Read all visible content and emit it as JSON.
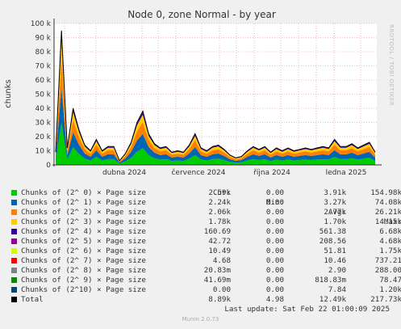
{
  "chart_data": {
    "type": "area",
    "title": "Node 0, zone Normal - by year",
    "ylabel": "chunks",
    "ylim": [
      0,
      100000
    ],
    "yticks": [
      0,
      10000,
      20000,
      30000,
      40000,
      50000,
      60000,
      70000,
      80000,
      90000,
      100000
    ],
    "ytick_labels": [
      "0",
      "10 k",
      "20 k",
      "30 k",
      "40 k",
      "50 k",
      "60 k",
      "70 k",
      "80 k",
      "90 k",
      "100 k"
    ],
    "x_tick_labels": [
      "dubna 2024",
      "července 2024",
      "října 2024",
      "ledna 2025"
    ],
    "grid": true,
    "stacked": true,
    "total_line_color": "#000000",
    "series_colors": [
      "#00cc00",
      "#0066b3",
      "#ff8000",
      "#ffcc00",
      "#330099",
      "#990099",
      "#ccff00",
      "#ff0000",
      "#808080",
      "#008f00",
      "#00487d"
    ],
    "total_values": [
      9000,
      95000,
      12000,
      40000,
      25000,
      14000,
      10000,
      18000,
      10000,
      13000,
      13000,
      3000,
      8000,
      16000,
      30000,
      38000,
      22000,
      15000,
      12000,
      13000,
      9000,
      10000,
      9000,
      14000,
      22000,
      12000,
      10000,
      13000,
      14000,
      11000,
      7000,
      5000,
      6000,
      10000,
      13000,
      11000,
      13000,
      9000,
      12000,
      10000,
      12000,
      10000,
      11000,
      12000,
      11000,
      12000,
      13000,
      12000,
      18000,
      13000,
      13000,
      15000,
      12000,
      14000,
      16000,
      9000
    ]
  },
  "legend": {
    "headers": {
      "cur": "Cur:",
      "min": "Min:",
      "avg": "Avg:",
      "max": "Max:"
    },
    "rows": [
      {
        "label": "Chunks of (2^ 0) × Page size",
        "color": "#00cc00",
        "cur": "2.59k",
        "min": "0.00",
        "avg": "3.91k",
        "max": "154.98k"
      },
      {
        "label": "Chunks of (2^ 1) × Page size",
        "color": "#0066b3",
        "cur": "2.24k",
        "min": "0.00",
        "avg": "3.27k",
        "max": "74.08k"
      },
      {
        "label": "Chunks of (2^ 2) × Page size",
        "color": "#ff8000",
        "cur": "2.06k",
        "min": "0.00",
        "avg": "2.77k",
        "max": "26.21k"
      },
      {
        "label": "Chunks of (2^ 3) × Page size",
        "color": "#ffcc00",
        "cur": "1.78k",
        "min": "0.00",
        "avg": "1.70k",
        "max": "14.15k"
      },
      {
        "label": "Chunks of (2^ 4) × Page size",
        "color": "#330099",
        "cur": "160.69",
        "min": "0.00",
        "avg": "561.38",
        "max": "6.68k"
      },
      {
        "label": "Chunks of (2^ 5) × Page size",
        "color": "#990099",
        "cur": "42.72",
        "min": "0.00",
        "avg": "208.56",
        "max": "4.68k"
      },
      {
        "label": "Chunks of (2^ 6) × Page size",
        "color": "#ccff00",
        "cur": "10.49",
        "min": "0.00",
        "avg": "51.81",
        "max": "1.75k"
      },
      {
        "label": "Chunks of (2^ 7) × Page size",
        "color": "#ff0000",
        "cur": "4.68",
        "min": "0.00",
        "avg": "10.46",
        "max": "737.21"
      },
      {
        "label": "Chunks of (2^ 8) × Page size",
        "color": "#808080",
        "cur": "20.83m",
        "min": "0.00",
        "avg": "2.90",
        "max": "288.00"
      },
      {
        "label": "Chunks of (2^ 9) × Page size",
        "color": "#008f00",
        "cur": "41.69m",
        "min": "0.00",
        "avg": "818.83m",
        "max": "78.47"
      },
      {
        "label": "Chunks of (2^10) × Page size",
        "color": "#00487d",
        "cur": "0.00",
        "min": "0.00",
        "avg": "7.84",
        "max": "1.20k"
      },
      {
        "label": "Total",
        "color": "#000000",
        "cur": "8.89k",
        "min": "4.98",
        "avg": "12.49k",
        "max": "217.73k"
      }
    ]
  },
  "last_update": "Last update: Sat Feb 22 01:00:09 2025",
  "munin_version": "Munin 2.0.73",
  "rrd_credit": "RRDTOOL / TOBI OETIKER"
}
